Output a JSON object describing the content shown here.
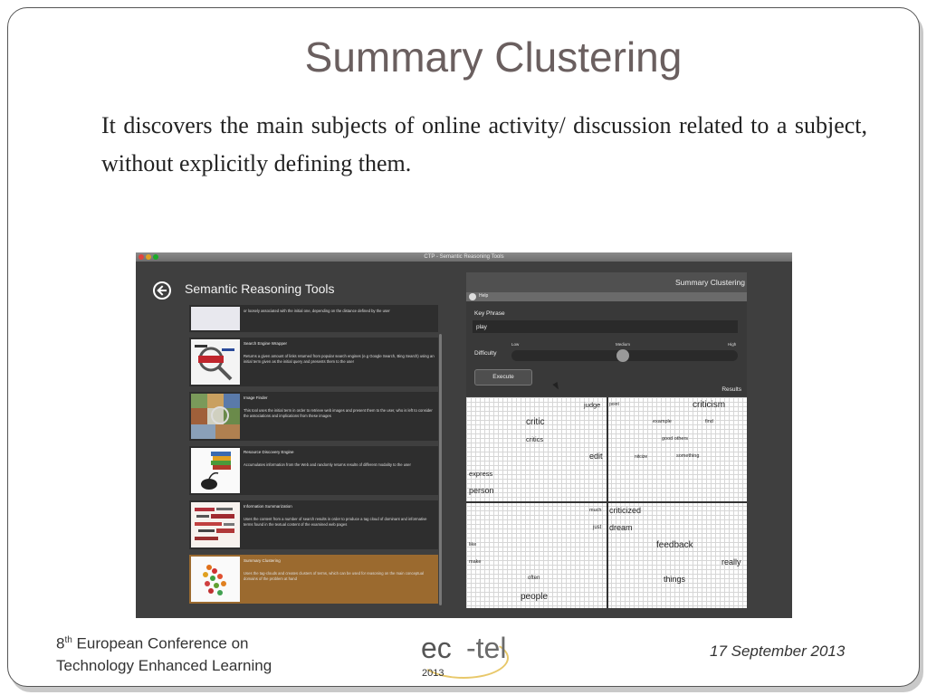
{
  "slide": {
    "title": "Summary Clustering",
    "body": "It discovers the main subjects of online activity/ discussion related to a subject, without explicitly defining them.",
    "footer_line1_prefix": "8",
    "footer_line1_sup": "th",
    "footer_line1_rest": " European Conference on",
    "footer_line2": "Technology Enhanced Learning",
    "date": "17 September 2013",
    "logo_ec": "ec",
    "logo_tel": "-tel",
    "logo_year": "2013"
  },
  "app": {
    "window_title": "CTP - Semantic Reasoning Tools",
    "heading": "Semantic Reasoning Tools",
    "tools": [
      {
        "name": "",
        "desc": "or loosely associated with the initial one, depending on the distance defined by the user"
      },
      {
        "name": "Search Engine Wrapper",
        "desc": "Returns a given amount of links returned from popular search engines (e.g Google Search, Bing Search) using an initial term given as the initial query and presents them to the user"
      },
      {
        "name": "Image Finder",
        "desc": "This tool uses the initial term in order to retrieve web images and present them to the user, who is left to consider the associations and implications from these images"
      },
      {
        "name": "Resource Discovery Engine",
        "desc": "Accumulates information from the Web and randomly returns results of different modality to the user"
      },
      {
        "name": "Information Summarization",
        "desc": "Uses the content from a number of search results in order to produce a tag cloud of dominant and informative terms found in the textual content of the examined web pages"
      },
      {
        "name": "Summary Clustering",
        "desc": "Uses the tag-clouds and creates clusters of terms, which can be used for reasoning on the main conceptual domains of the problem at hand"
      }
    ],
    "panel": {
      "header": "Summary Clustering",
      "help": "Help",
      "key_phrase_label": "Key Phrase",
      "key_phrase_value": "play",
      "difficulty_label": "Difficulty",
      "tick_low": "Low",
      "tick_medium": "Medium",
      "tick_high": "High",
      "difficulty_level": 0.5,
      "execute_label": "Execute",
      "results_label": "Results"
    },
    "terms": {
      "judge": "judge",
      "point": "point",
      "criticism": "criticism",
      "critic": "critic",
      "example": "example",
      "find": "find",
      "critics": "critics",
      "good_others": "good others",
      "edit": "edit",
      "nitcize": "nitcize",
      "something": "something",
      "express": "express",
      "person": "person",
      "much": "much",
      "criticized": "criticized",
      "just": "just",
      "dream": "dream",
      "like": "like",
      "feedback": "feedback",
      "make": "make",
      "really": "really",
      "often": "often",
      "things": "things",
      "people": "people"
    }
  }
}
